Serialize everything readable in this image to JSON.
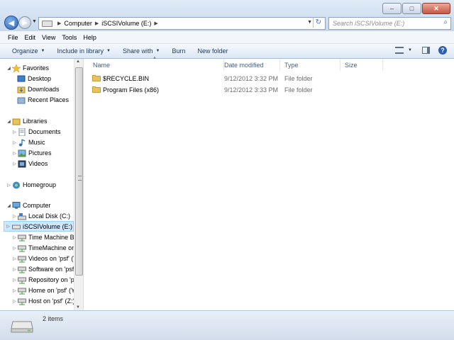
{
  "window": {
    "controls": {
      "minimize": "–",
      "maximize": "□",
      "close": "✕"
    }
  },
  "address_bar": {
    "crumbs": [
      "Computer",
      "iSCSIVolume (E:)"
    ],
    "search_placeholder": "Search iSCSIVolume (E:)"
  },
  "menu": [
    "File",
    "Edit",
    "View",
    "Tools",
    "Help"
  ],
  "commands": [
    {
      "label": "Organize",
      "dropdown": true
    },
    {
      "label": "Include in library",
      "dropdown": true
    },
    {
      "label": "Share with",
      "dropdown": true
    },
    {
      "label": "Burn",
      "dropdown": false
    },
    {
      "label": "New folder",
      "dropdown": false
    }
  ],
  "nav": {
    "favorites": {
      "label": "Favorites",
      "items": [
        "Desktop",
        "Downloads",
        "Recent Places"
      ]
    },
    "libraries": {
      "label": "Libraries",
      "items": [
        "Documents",
        "Music",
        "Pictures",
        "Videos"
      ]
    },
    "homegroup": {
      "label": "Homegroup"
    },
    "computer": {
      "label": "Computer",
      "items": [
        "Local Disk (C:)",
        "iSCSIVolume (E:)",
        "Time Machine Ba",
        "TimeMachine on",
        "Videos on 'psf' (V",
        "Software on 'psf'",
        "Repository on 'ps",
        "Home on 'psf' (Y",
        "Host on 'psf' (Z:)"
      ],
      "selected": 1
    }
  },
  "columns": [
    "Name",
    "Date modified",
    "Type",
    "Size"
  ],
  "files": [
    {
      "name": "$RECYCLE.BIN",
      "date": "9/12/2012 3:32 PM",
      "type": "File folder",
      "size": ""
    },
    {
      "name": "Program Files (x86)",
      "date": "9/12/2012 3:33 PM",
      "type": "File folder",
      "size": ""
    }
  ],
  "status": {
    "item_count": "2 items"
  },
  "colors": {
    "folder": "#e8c25a",
    "selection": "#cde8ff",
    "accent": "#1e395b"
  }
}
